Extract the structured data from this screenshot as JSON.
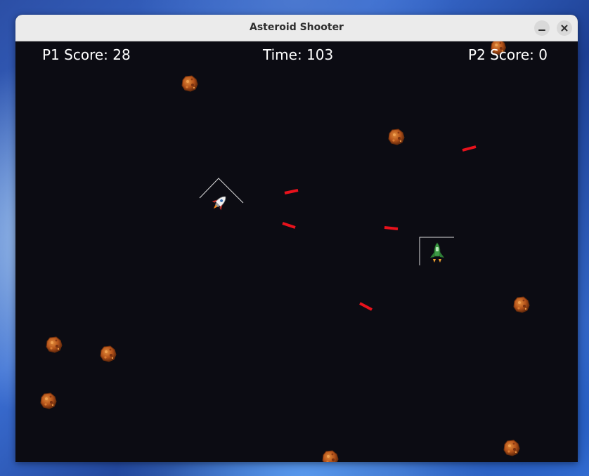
{
  "window": {
    "title": "Asteroid Shooter"
  },
  "hud": {
    "p1_score": "P1 Score: 28",
    "time": "Time: 103",
    "p2_score": "P2 Score: 0"
  },
  "colors": {
    "background": "#0c0c13",
    "laser": "#e8121c",
    "asteroid": "#b5531a",
    "hud_text": "#ffffff",
    "shield_outline": "#dcdcdc"
  },
  "icons": {
    "minimize": "minimize-icon",
    "close": "close-icon",
    "player1": "rocket-ship-icon",
    "player2": "green-fighter-ship-icon",
    "asteroid": "asteroid-icon",
    "laser": "laser-bolt-icon"
  }
}
